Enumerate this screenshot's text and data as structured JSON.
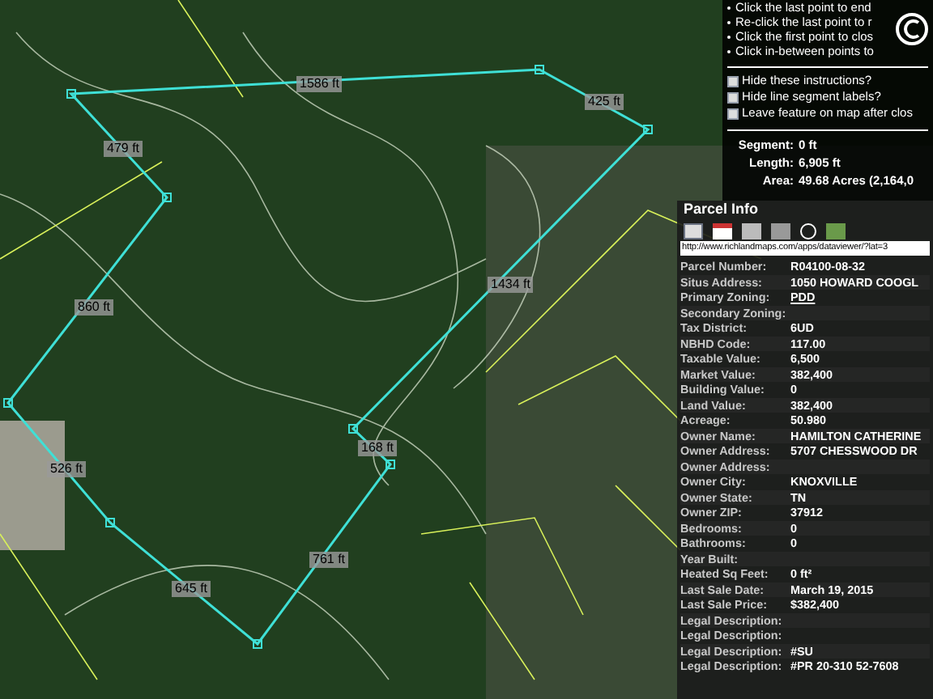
{
  "map": {
    "segment_labels": [
      {
        "text": "1586 ft"
      },
      {
        "text": "425 ft"
      },
      {
        "text": "479 ft"
      },
      {
        "text": "860 ft"
      },
      {
        "text": "1434 ft"
      },
      {
        "text": "168 ft"
      },
      {
        "text": "526 ft"
      },
      {
        "text": "761 ft"
      },
      {
        "text": "645 ft"
      }
    ]
  },
  "instructions": {
    "steps": [
      "Click the last point to end",
      "Re-click the last point to r",
      "Click the first point to clos",
      "Click in-between points to"
    ],
    "options": [
      {
        "label": "Hide these instructions?",
        "checked": false
      },
      {
        "label": "Hide line segment labels?",
        "checked": false
      },
      {
        "label": "Leave feature on map after clos",
        "checked": false
      }
    ],
    "measurements": [
      {
        "label": "Segment:",
        "value": "0 ft"
      },
      {
        "label": "Length:",
        "value": "6,905 ft"
      },
      {
        "label": "Area:",
        "value": "49.68 Acres (2,164,0"
      }
    ]
  },
  "parcel": {
    "title": "Parcel Info",
    "url": "http://www.richlandmaps.com/apps/dataviewer/?lat=3",
    "rows": [
      {
        "label": "Parcel Number:",
        "value": "R04100-08-32",
        "kind": "text"
      },
      {
        "label": "Situs Address:",
        "value": "1050 HOWARD COOGL",
        "kind": "text"
      },
      {
        "label": "Primary Zoning:",
        "value": "PDD",
        "kind": "link"
      },
      {
        "label": "Secondary Zoning:",
        "value": "",
        "kind": "text"
      },
      {
        "label": "Tax District:",
        "value": "6UD",
        "kind": "text"
      },
      {
        "label": "NBHD Code:",
        "value": "117.00",
        "kind": "text"
      },
      {
        "label": "Taxable Value:",
        "value": "6,500",
        "kind": "text"
      },
      {
        "label": "Market Value:",
        "value": "382,400",
        "kind": "text"
      },
      {
        "label": "Building Value:",
        "value": "0",
        "kind": "text"
      },
      {
        "label": "Land Value:",
        "value": "382,400",
        "kind": "text"
      },
      {
        "label": "Acreage:",
        "value": "50.980",
        "kind": "text"
      },
      {
        "label": "Owner Name:",
        "value": "HAMILTON CATHERINE",
        "kind": "text"
      },
      {
        "label": "Owner Address:",
        "value": "5707 CHESSWOOD DR",
        "kind": "text"
      },
      {
        "label": "Owner Address:",
        "value": "",
        "kind": "text"
      },
      {
        "label": "Owner City:",
        "value": "KNOXVILLE",
        "kind": "text"
      },
      {
        "label": "Owner State:",
        "value": "TN",
        "kind": "text"
      },
      {
        "label": "Owner ZIP:",
        "value": "37912",
        "kind": "text"
      },
      {
        "label": "Bedrooms:",
        "value": "0",
        "kind": "text"
      },
      {
        "label": "Bathrooms:",
        "value": "0",
        "kind": "text"
      },
      {
        "label": "Year Built:",
        "value": "",
        "kind": "text"
      },
      {
        "label": "Heated Sq Feet:",
        "value": "0 ft²",
        "kind": "text"
      },
      {
        "label": "Last Sale Date:",
        "value": "March 19, 2015",
        "kind": "text"
      },
      {
        "label": "Last Sale Price:",
        "value": "$382,400",
        "kind": "text"
      },
      {
        "label": "Legal Description:",
        "value": "",
        "kind": "text"
      },
      {
        "label": "Legal Description:",
        "value": "",
        "kind": "text"
      },
      {
        "label": "Legal Description:",
        "value": "#SU",
        "kind": "text"
      },
      {
        "label": "Legal Description:",
        "value": "#PR 20-310 52-7608",
        "kind": "text"
      }
    ]
  }
}
